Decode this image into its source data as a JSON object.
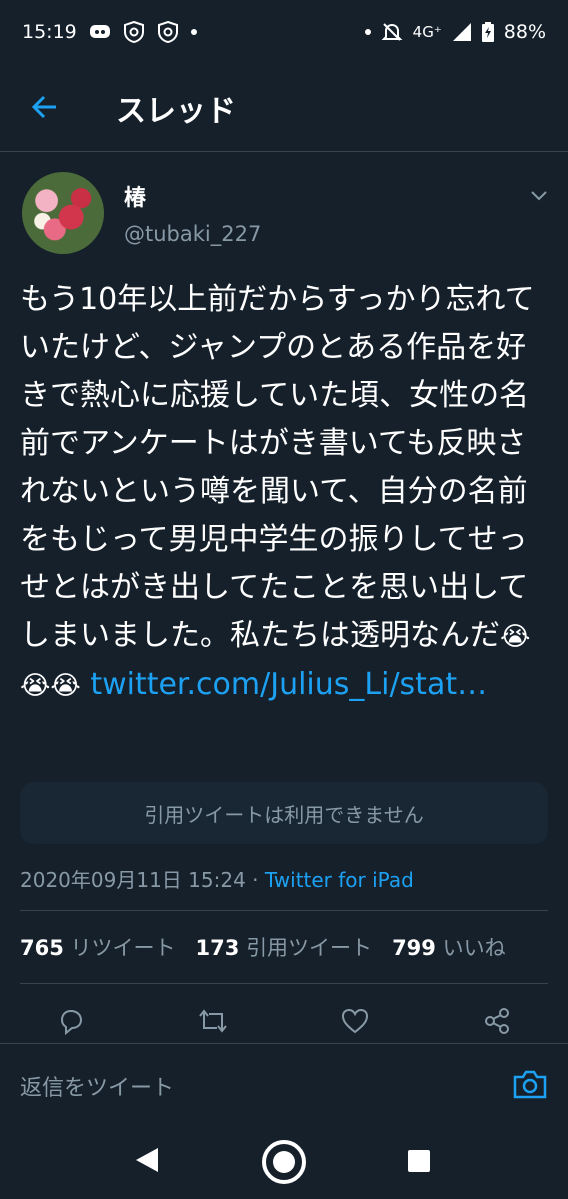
{
  "status_bar": {
    "time": "15:19",
    "network": "4G⁺",
    "battery": "88%"
  },
  "header": {
    "title": "スレッド"
  },
  "tweet": {
    "display_name": "椿",
    "handle": "@tubaki_227",
    "text": "もう10年以上前だからすっかり忘れていたけど、ジャンプのとある作品を好きで熱心に応援していた頃、女性の名前でアンケートはがき書いても反映されないという噂を聞いて、自分の名前をもじって男児中学生の振りしてせっせとはがき出してたことを思い出してしまいました。私たちは透明なんだ",
    "emojis": "😭😭😭",
    "link": "twitter.com/Julius_Li/stat…",
    "quote_unavailable": "引用ツイートは利用できません",
    "timestamp": "2020年09月11日 15:24",
    "separator": " · ",
    "source": "Twitter for iPad",
    "retweets_count": "765",
    "retweets_label": "リツイート",
    "quotes_count": "173",
    "quotes_label": "引用ツイート",
    "likes_count": "799",
    "likes_label": "いいね"
  },
  "reply": {
    "placeholder": "返信をツイート"
  },
  "colors": {
    "background": "#15202b",
    "accent": "#1da1f2",
    "muted": "#8899a6",
    "divider": "#38444d"
  },
  "icons": [
    "back-arrow-icon",
    "chevron-down-icon",
    "reply-icon",
    "retweet-icon",
    "like-icon",
    "share-icon",
    "camera-icon"
  ]
}
